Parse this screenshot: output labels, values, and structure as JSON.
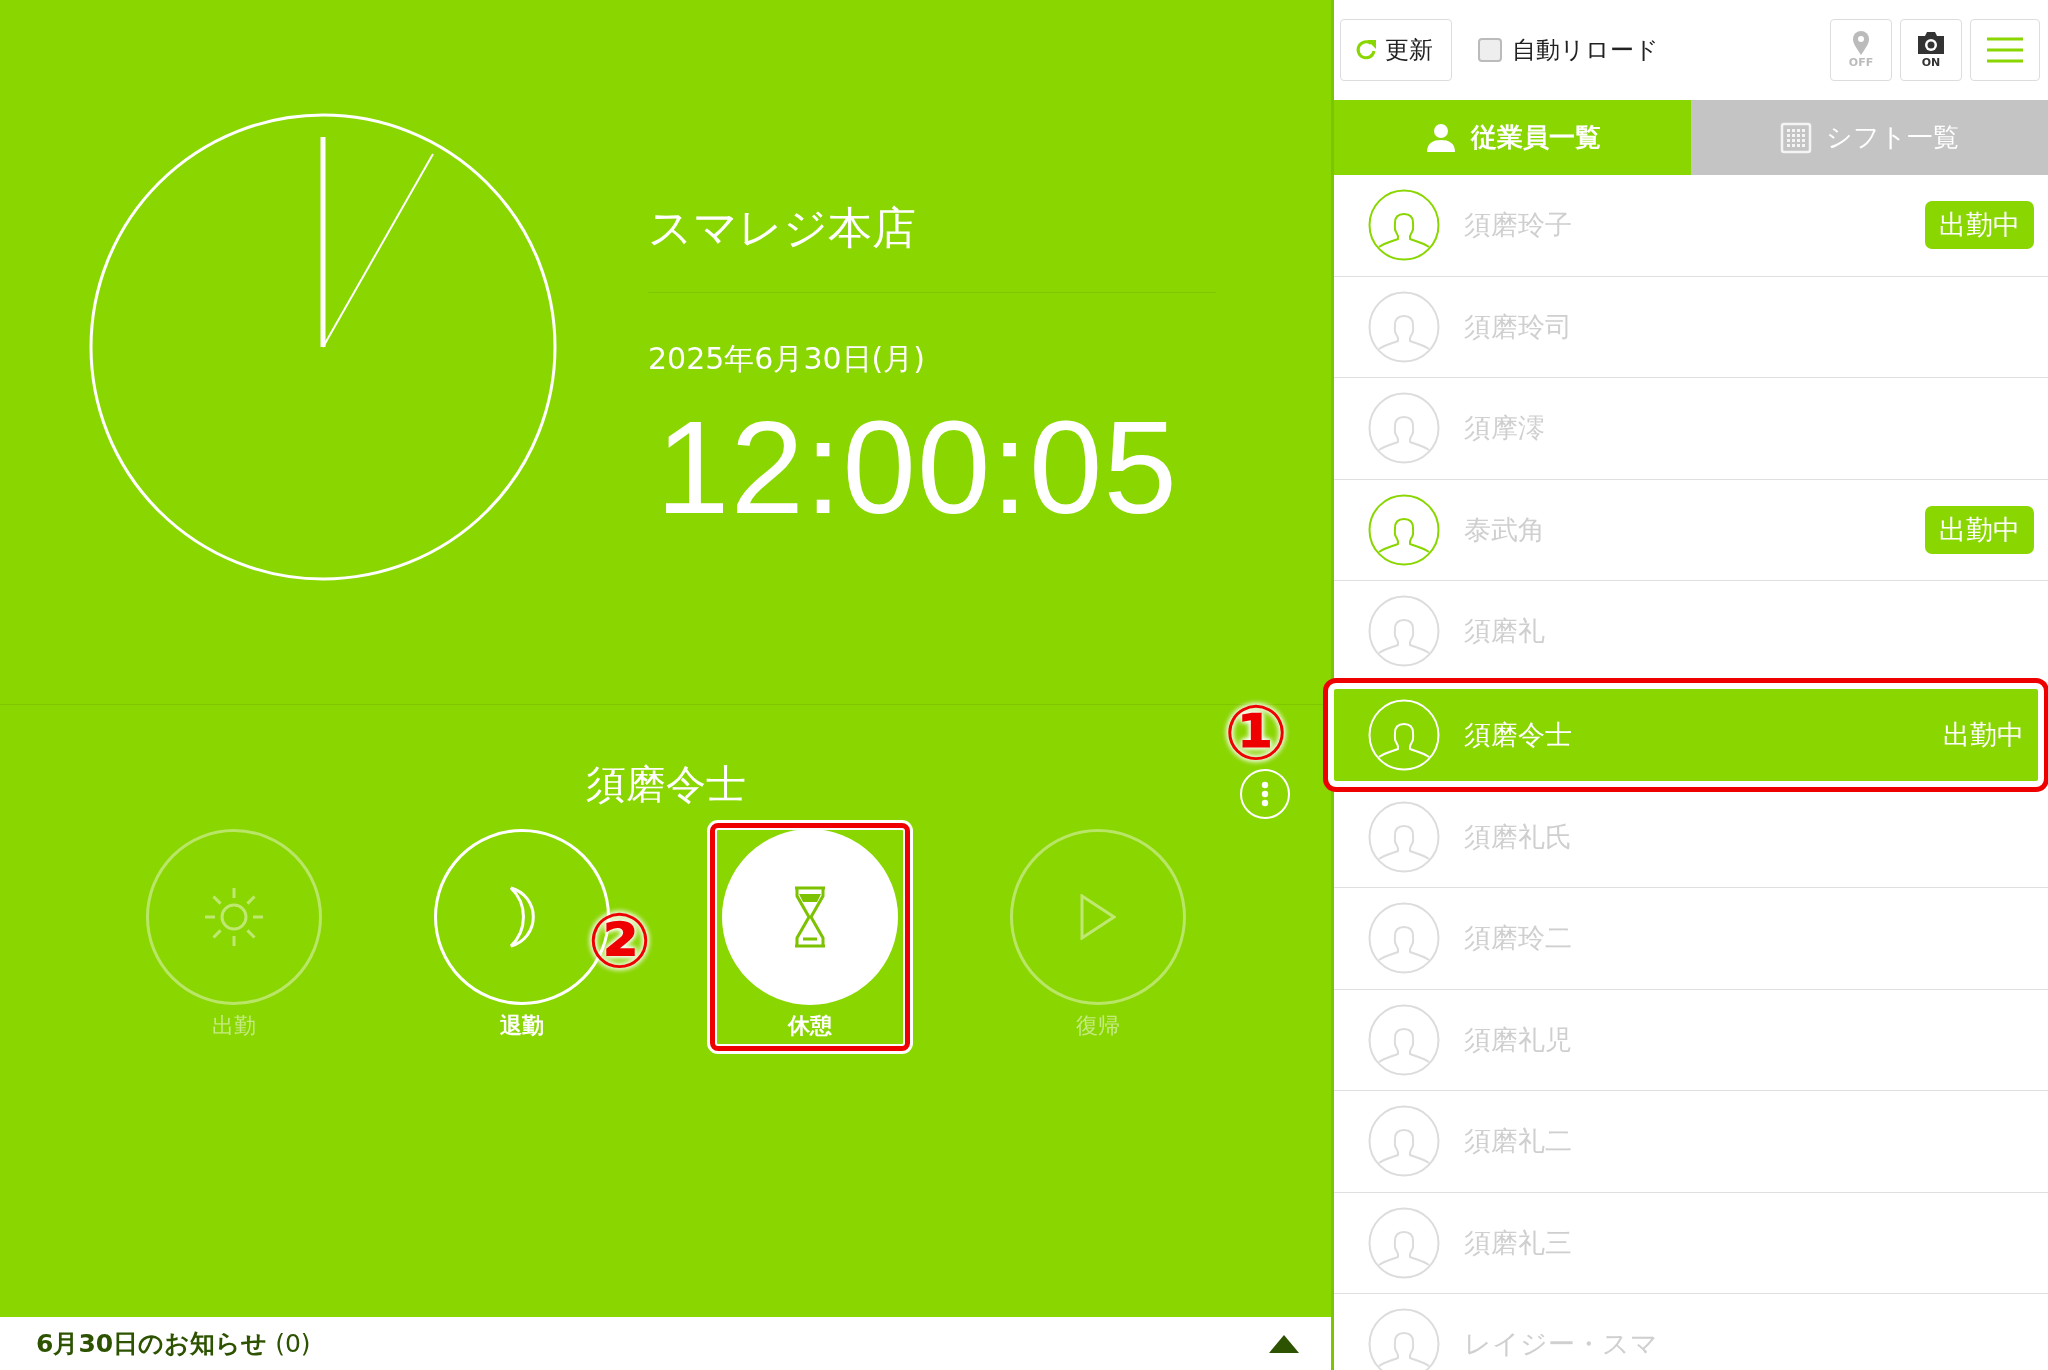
{
  "clock": {
    "store": "スマレジ本店",
    "date": "2025年6月30日(月)",
    "time": "12:00:05"
  },
  "punch": {
    "employee": "須磨令士",
    "buttons": [
      {
        "label": "出勤",
        "disabled": true,
        "active": false
      },
      {
        "label": "退勤",
        "disabled": false,
        "active": false
      },
      {
        "label": "休憩",
        "disabled": false,
        "active": true,
        "callout": "②"
      },
      {
        "label": "復帰",
        "disabled": true,
        "active": false
      }
    ]
  },
  "notice": {
    "text": "**6月30日のお知らせ** (0)",
    "expanded": false
  },
  "toolbar": {
    "refresh": "更新",
    "auto_reload": {
      "label": "自動リロード",
      "checked": false
    },
    "location": {
      "label": "OFF",
      "on": false
    },
    "camera": {
      "label": "ON",
      "on": true
    }
  },
  "tabs": [
    {
      "label": "従業員一覧",
      "selected": true
    },
    {
      "label": "シフト一覧",
      "selected": false
    }
  ],
  "employees": [
    {
      "name": "須磨玲子",
      "working": true,
      "selected": false,
      "status": "出勤中"
    },
    {
      "name": "須磨玲司",
      "working": false,
      "selected": false
    },
    {
      "name": "須摩澪",
      "working": false,
      "selected": false
    },
    {
      "name": "泰武角",
      "working": true,
      "selected": false,
      "status": "出勤中"
    },
    {
      "name": "須磨礼",
      "working": false,
      "selected": false
    },
    {
      "name": "須磨令士",
      "working": true,
      "selected": true,
      "status": "出勤中",
      "callout": "①"
    },
    {
      "name": "須磨礼氏",
      "working": false,
      "selected": false
    },
    {
      "name": "須磨玲二",
      "working": false,
      "selected": false
    },
    {
      "name": "須磨礼児",
      "working": false,
      "selected": false
    },
    {
      "name": "須磨礼二",
      "working": false,
      "selected": false
    },
    {
      "name": "須磨礼三",
      "working": false,
      "selected": false
    },
    {
      "name": "レイジー・スマ",
      "working": false,
      "selected": false
    }
  ]
}
